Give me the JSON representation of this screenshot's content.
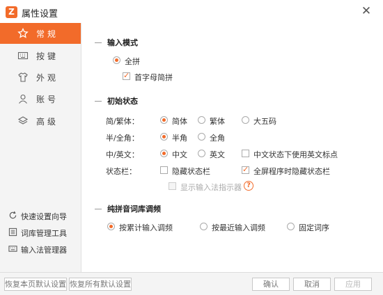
{
  "window": {
    "title": "属性设置"
  },
  "sidebar": {
    "items": [
      {
        "label": "常规",
        "icon": "star-icon",
        "active": true
      },
      {
        "label": "按键",
        "icon": "keyboard-icon",
        "active": false
      },
      {
        "label": "外观",
        "icon": "tshirt-icon",
        "active": false
      },
      {
        "label": "账号",
        "icon": "user-icon",
        "active": false
      },
      {
        "label": "高级",
        "icon": "layers-icon",
        "active": false
      }
    ],
    "links": [
      {
        "label": "快速设置向导",
        "icon": "refresh-icon"
      },
      {
        "label": "词库管理工具",
        "icon": "book-icon"
      },
      {
        "label": "输入法管理器",
        "icon": "keyboard-icon"
      }
    ]
  },
  "sections": {
    "input_mode": {
      "title": "输入模式",
      "full_pinyin": "全拼",
      "initial_abbr": "首字母简拼"
    },
    "initial_state": {
      "title": "初始状态",
      "trad_label": "简/繁体：",
      "trad_options": [
        "简体",
        "繁体",
        "大五码"
      ],
      "width_label": "半/全角：",
      "width_options": [
        "半角",
        "全角"
      ],
      "lang_label": "中/英文：",
      "lang_options": [
        "中文",
        "英文"
      ],
      "lang_check": "中文状态下使用英文标点",
      "statusbar_label": "状态栏：",
      "hide_statusbar": "隐藏状态栏",
      "fullscreen_hide": "全屏程序时隐藏状态栏",
      "show_indicator": "显示输入法指示器",
      "help": "?"
    },
    "pinyin_tuning": {
      "title": "纯拼音词库调频",
      "options": [
        "按累计输入调频",
        "按最近输入调频",
        "固定词序"
      ]
    }
  },
  "footer": {
    "restore_page": "恢复本页默认设置",
    "restore_all": "恢复所有默认设置",
    "ok": "确认",
    "cancel": "取消",
    "apply": "应用"
  },
  "colors": {
    "accent": "#f26b2a",
    "sidebar_bg": "#f4f4f4"
  }
}
